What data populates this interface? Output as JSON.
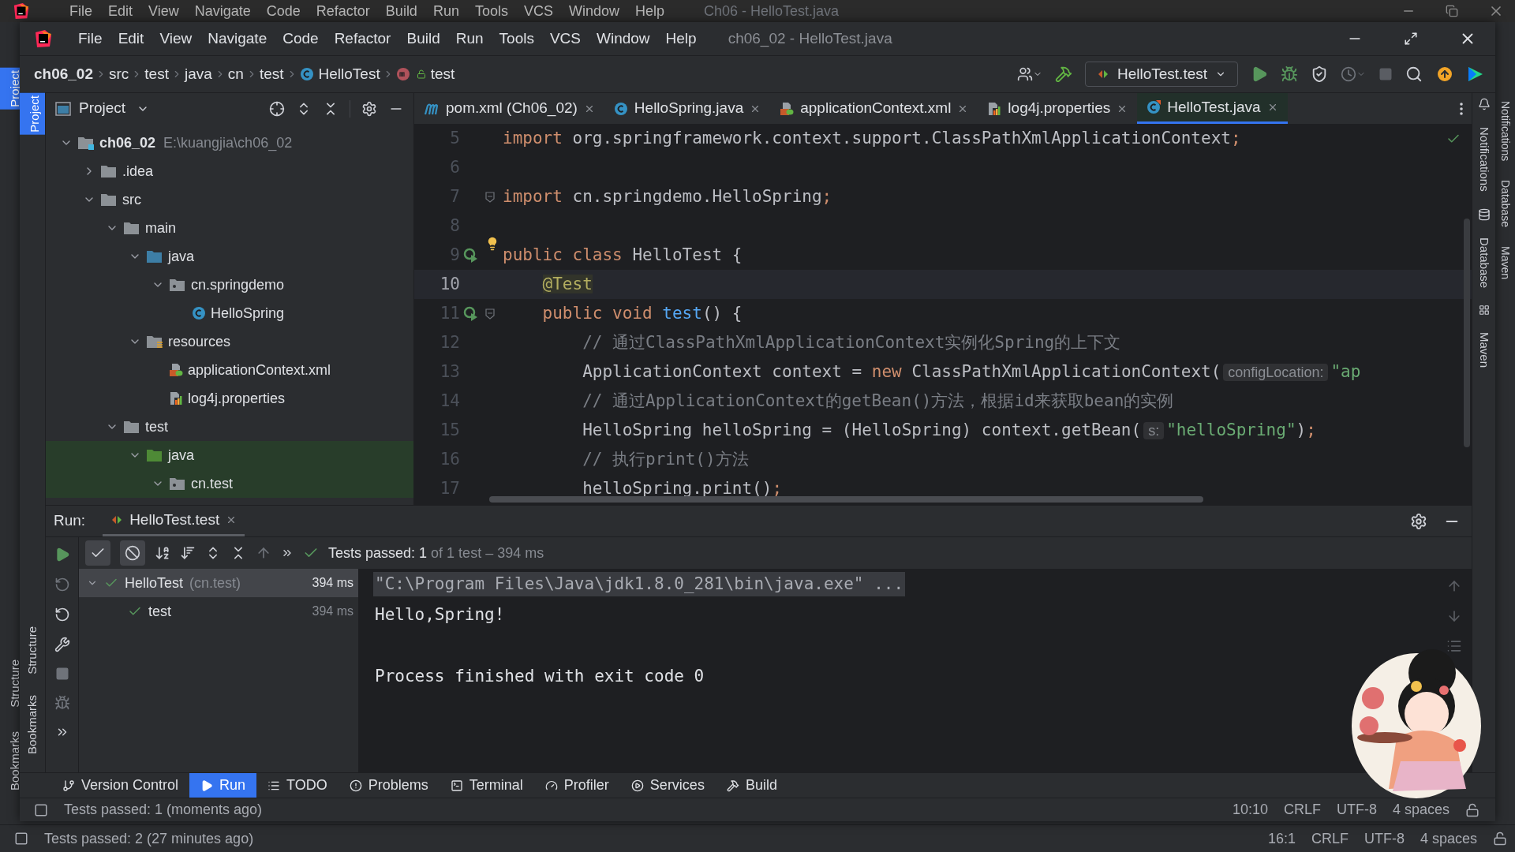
{
  "back_window": {
    "title": "Ch06 - HelloTest.java",
    "menu": [
      "File",
      "Edit",
      "View",
      "Navigate",
      "Code",
      "Refactor",
      "Build",
      "Run",
      "Tools",
      "VCS",
      "Window",
      "Help"
    ],
    "left_tools": [
      {
        "label": "Project",
        "selected": true
      },
      {
        "label": "Structure",
        "selected": false
      },
      {
        "label": "Bookmarks",
        "selected": false
      }
    ],
    "right_tools": [
      "Notifications",
      "Database",
      "Maven"
    ],
    "status_bar": {
      "message": "Tests passed: 2 (27 minutes ago)",
      "items": [
        "16:1",
        "CRLF",
        "UTF-8",
        "4 spaces"
      ]
    }
  },
  "window": {
    "title": "ch06_02 - HelloTest.java",
    "menu": [
      "File",
      "Edit",
      "View",
      "Navigate",
      "Code",
      "Refactor",
      "Build",
      "Run",
      "Tools",
      "VCS",
      "Window",
      "Help"
    ],
    "breadcrumbs": [
      {
        "label": "ch06_02",
        "kind": "project"
      },
      {
        "label": "src",
        "kind": "dir"
      },
      {
        "label": "test",
        "kind": "dir"
      },
      {
        "label": "java",
        "kind": "dir"
      },
      {
        "label": "cn",
        "kind": "dir"
      },
      {
        "label": "test",
        "kind": "dir"
      },
      {
        "label": "HelloTest",
        "kind": "class"
      },
      {
        "label": "test",
        "kind": "method"
      }
    ],
    "run_config": "HelloTest.test",
    "left_tools": [
      {
        "label": "Project",
        "selected": true
      },
      {
        "label": "Structure",
        "selected": false
      },
      {
        "label": "Bookmarks",
        "selected": false
      }
    ],
    "right_tools": [
      "Notifications",
      "Database",
      "Maven"
    ],
    "project_panel": {
      "title": "Project",
      "tree": [
        {
          "label": "ch06_02",
          "path": "E:\\kuangjia\\ch06_02",
          "kind": "module",
          "expanded": true,
          "children": [
            {
              "label": ".idea",
              "kind": "folder",
              "expanded": false
            },
            {
              "label": "src",
              "kind": "folder",
              "expanded": true,
              "children": [
                {
                  "label": "main",
                  "kind": "folder",
                  "expanded": true,
                  "children": [
                    {
                      "label": "java",
                      "kind": "source",
                      "expanded": true,
                      "children": [
                        {
                          "label": "cn.springdemo",
                          "kind": "package",
                          "expanded": true,
                          "children": [
                            {
                              "label": "HelloSpring",
                              "kind": "class"
                            }
                          ]
                        }
                      ]
                    },
                    {
                      "label": "resources",
                      "kind": "resources",
                      "expanded": true,
                      "children": [
                        {
                          "label": "applicationContext.xml",
                          "kind": "xml"
                        },
                        {
                          "label": "log4j.properties",
                          "kind": "properties"
                        }
                      ]
                    }
                  ]
                },
                {
                  "label": "test",
                  "kind": "folder",
                  "expanded": true,
                  "children": [
                    {
                      "label": "java",
                      "kind": "test-source",
                      "expanded": true,
                      "test_scope": true,
                      "children": [
                        {
                          "label": "cn.test",
                          "kind": "package",
                          "expanded": true,
                          "test_scope": true
                        }
                      ]
                    }
                  ]
                }
              ]
            }
          ]
        }
      ]
    },
    "editor": {
      "tabs": [
        {
          "label": "pom.xml (Ch06_02)",
          "kind": "maven",
          "selected": false
        },
        {
          "label": "HelloSpring.java",
          "kind": "class",
          "selected": false
        },
        {
          "label": "applicationContext.xml",
          "kind": "xml",
          "selected": false
        },
        {
          "label": "log4j.properties",
          "kind": "properties",
          "selected": false
        },
        {
          "label": "HelloTest.java",
          "kind": "test-class",
          "selected": true
        }
      ],
      "lines": [
        {
          "number": "5",
          "segments": [
            {
              "kind": "kw",
              "text": "import"
            },
            {
              "kind": "plain",
              "text": " org.springframework.context.support.ClassPathXmlApplicationContext"
            },
            {
              "kind": "kw",
              "text": ";"
            }
          ]
        },
        {
          "number": "6"
        },
        {
          "number": "7",
          "fold": true,
          "segments": [
            {
              "kind": "kw",
              "text": "import"
            },
            {
              "kind": "plain",
              "text": " cn.springdemo.HelloSpring"
            },
            {
              "kind": "kw",
              "text": ";"
            }
          ]
        },
        {
          "number": "8"
        },
        {
          "number": "9",
          "run_marker": true,
          "intention": true,
          "segments": [
            {
              "kind": "kw",
              "text": "public class "
            },
            {
              "kind": "plain",
              "text": "HelloTest {"
            }
          ]
        },
        {
          "number": "10",
          "current": true,
          "segments": [
            {
              "kind": "ann",
              "text": "    @Test"
            }
          ]
        },
        {
          "number": "11",
          "run_marker": true,
          "fold": true,
          "segments": [
            {
              "kind": "kw",
              "text": "    public void "
            },
            {
              "kind": "fn",
              "text": "test"
            },
            {
              "kind": "plain",
              "text": "() {"
            }
          ]
        },
        {
          "number": "12",
          "segments": [
            {
              "kind": "cmt",
              "text": "        // 通过ClassPathXmlApplicationContext实例化Spring的上下文"
            }
          ]
        },
        {
          "number": "13",
          "segments": [
            {
              "kind": "plain",
              "text": "        ApplicationContext context = "
            },
            {
              "kind": "kw",
              "text": "new "
            },
            {
              "kind": "plain",
              "text": "ClassPathXmlApplicationContext("
            },
            {
              "kind": "hint",
              "text": "configLocation:"
            },
            {
              "kind": "str",
              "text": "\"ap"
            }
          ]
        },
        {
          "number": "14",
          "segments": [
            {
              "kind": "cmt",
              "text": "        // 通过ApplicationContext的getBean()方法，根据id来获取bean的实例"
            }
          ]
        },
        {
          "number": "15",
          "segments": [
            {
              "kind": "plain",
              "text": "        HelloSpring helloSpring = (HelloSpring) context.getBean("
            },
            {
              "kind": "hint",
              "text": "s:"
            },
            {
              "kind": "str",
              "text": "\"helloSpring\""
            },
            {
              "kind": "plain",
              "text": ")"
            },
            {
              "kind": "kw",
              "text": ";"
            }
          ]
        },
        {
          "number": "16",
          "segments": [
            {
              "kind": "cmt",
              "text": "        // 执行print()方法"
            }
          ]
        },
        {
          "number": "17",
          "segments": [
            {
              "kind": "plain",
              "text": "        helloSpring.print()"
            },
            {
              "kind": "kw",
              "text": ";"
            }
          ]
        }
      ]
    },
    "run_panel": {
      "title": "Run:",
      "tab": "HelloTest.test",
      "filters": [
        {
          "kind": "passed",
          "selected": true
        },
        {
          "kind": "ignored",
          "selected": true
        }
      ],
      "summary": {
        "passed": "Tests passed: 1",
        "detail": "of 1 test – 394 ms"
      },
      "tests": [
        {
          "label": "HelloTest",
          "package": "(cn.test)",
          "time": "394 ms",
          "selected": true,
          "expanded": true,
          "children": [
            {
              "label": "test",
              "time": "394 ms",
              "selected": false
            }
          ]
        }
      ],
      "console": [
        {
          "kind": "command",
          "text": "\"C:\\Program Files\\Java\\jdk1.8.0_281\\bin\\java.exe\" ..."
        },
        {
          "kind": "output",
          "text": "Hello,Spring!"
        },
        {
          "kind": "blank"
        },
        {
          "kind": "output",
          "text": "Process finished with exit code 0"
        }
      ]
    },
    "tool_tabs": [
      {
        "label": "Version Control",
        "kind": "vcs",
        "selected": false
      },
      {
        "label": "Run",
        "kind": "run",
        "selected": true
      },
      {
        "label": "TODO",
        "kind": "todo",
        "selected": false
      },
      {
        "label": "Problems",
        "kind": "problems",
        "selected": false
      },
      {
        "label": "Terminal",
        "kind": "terminal",
        "selected": false
      },
      {
        "label": "Profiler",
        "kind": "profiler",
        "selected": false
      },
      {
        "label": "Services",
        "kind": "services",
        "selected": false
      },
      {
        "label": "Build",
        "kind": "build",
        "selected": false
      }
    ],
    "status_bar": {
      "message": "Tests passed: 1 (moments ago)",
      "items": [
        "10:10",
        "CRLF",
        "UTF-8",
        "4 spaces"
      ]
    }
  }
}
